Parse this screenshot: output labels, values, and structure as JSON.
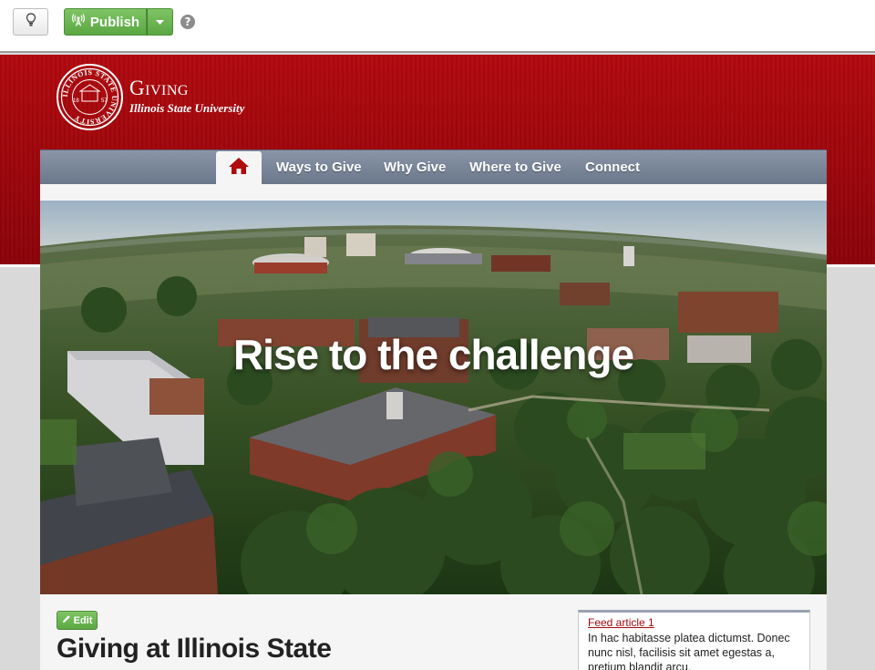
{
  "toolbar": {
    "bulb_icon": "lightbulb-icon",
    "publish_label": "Publish",
    "publish_icon": "broadcast-icon",
    "caret_icon": "caret-down-icon",
    "help_label": "?"
  },
  "brand": {
    "title": "Giving",
    "subtitle": "Illinois State University",
    "seal_icon": "university-seal-icon",
    "seal_text": "ILLINOIS STATE UNIVERSITY",
    "seal_year_left": "18",
    "seal_year_right": "57"
  },
  "nav": {
    "home_icon": "home-icon",
    "items": [
      {
        "label": "Ways to Give"
      },
      {
        "label": "Why Give"
      },
      {
        "label": "Where to Give"
      },
      {
        "label": "Connect"
      }
    ]
  },
  "hero": {
    "heading": "Rise to the challenge"
  },
  "content": {
    "edit_label": "Edit",
    "edit_icon": "pencil-icon",
    "heading": "Giving at Illinois State"
  },
  "feed": {
    "link": "Feed article 1",
    "text": "In hac habitasse platea dictumst. Donec nunc nisl, facilisis sit amet egestas a, pretium blandit arcu."
  },
  "colors": {
    "brand_red": "#a3080e",
    "publish_green": "#5ba843",
    "nav_slate": "#7a8698"
  }
}
